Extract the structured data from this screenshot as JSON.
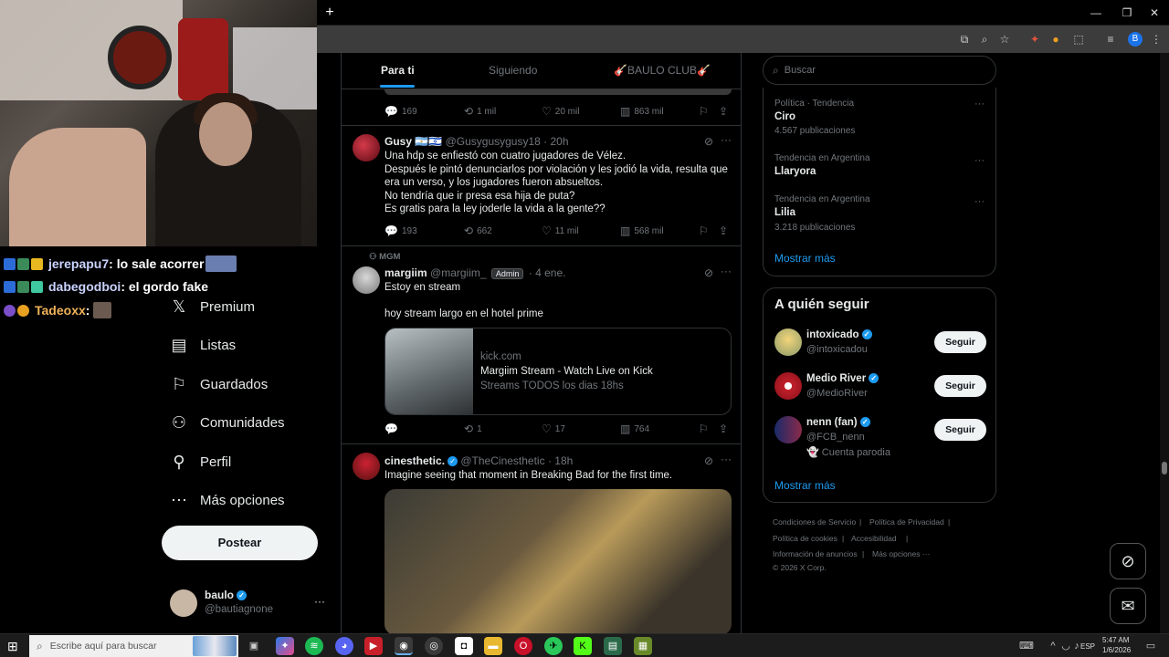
{
  "browser": {
    "newtab_label": "+",
    "minimize": "—",
    "restore": "❐",
    "close": "✕",
    "profile_initial": "B"
  },
  "chat": [
    {
      "user": "jerepapu7",
      "message": " : lo sale acorrer",
      "color": "#c9d3ff"
    },
    {
      "user": "dabegodboi",
      "message": " : el gordo fake",
      "color": "#c9d3ff"
    },
    {
      "user": "Tadeoxx",
      "message": " :",
      "color": "#f0b25a"
    }
  ],
  "nav": {
    "items": [
      {
        "label": "Premium",
        "icon": "x-logo-icon"
      },
      {
        "label": "Listas",
        "icon": "list-icon"
      },
      {
        "label": "Guardados",
        "icon": "bookmark-icon"
      },
      {
        "label": "Comunidades",
        "icon": "communities-icon"
      },
      {
        "label": "Perfil",
        "icon": "profile-icon"
      },
      {
        "label": "Más opciones",
        "icon": "more-options-icon"
      }
    ],
    "post_label": "Postear",
    "user_name": "baulo",
    "user_handle": "@bautiagnone",
    "user_more": "···"
  },
  "tabs": {
    "for_you": "Para ti",
    "following": "Siguiendo",
    "club": "🎸BAULO CLUB🎸"
  },
  "tweets": {
    "t0": {
      "replies": "169",
      "retweets": "1 mil",
      "likes": "20 mil",
      "views": "863 mil"
    },
    "t1": {
      "name": "Gusy 🇦🇷🇮🇱",
      "handle": "@Gusygusygusy18",
      "time": "· 20h",
      "line1": "Una hdp se enfiestó con cuatro jugadores de Vélez.",
      "line2": "Después le pintó denunciarlos por violación y les jodió la vida, resulta que era un verso, y los jugadores fueron absueltos.",
      "line3": "No tendría que ir presa esa hija de puta?",
      "line4": "Es gratis para la ley joderle la vida a la gente??",
      "replies": "193",
      "retweets": "662",
      "likes": "11 mil",
      "views": "568 mil"
    },
    "t2": {
      "context": "MGM",
      "name": "margiim",
      "handle": "@margiim_",
      "badge": "Admin",
      "time": "· 4 ene.",
      "line1": "Estoy en stream",
      "line2": "hoy stream largo en el hotel prime",
      "card_domain": "kick.com",
      "card_title": "Margiim Stream - Watch Live on Kick",
      "card_desc": "Streams TODOS los dias 18hs",
      "replies": "",
      "retweets": "1",
      "likes": "17",
      "views": "764"
    },
    "t3": {
      "name": "cinesthetic.",
      "handle": "@TheCinesthetic",
      "time": "· 18h",
      "line1": "Imagine seeing that moment in Breaking Bad for the first time."
    }
  },
  "search": {
    "placeholder": "Buscar"
  },
  "trends": [
    {
      "meta": "Política · Tendencia",
      "name": "Ciro",
      "posts": "4.567 publicaciones"
    },
    {
      "meta": "Tendencia en Argentina",
      "name": "Llaryora",
      "posts": ""
    },
    {
      "meta": "Tendencia en Argentina",
      "name": "Lilia",
      "posts": "3.218 publicaciones"
    }
  ],
  "trends_more": "Mostrar más",
  "follow": {
    "title": "A quién seguir",
    "button": "Seguir",
    "more": "Mostrar más",
    "people": [
      {
        "name": "intoxicado",
        "handle": "@intoxicadou",
        "extra": ""
      },
      {
        "name": "Medio River",
        "handle": "@MedioRiver",
        "extra": ""
      },
      {
        "name": "nenn (fan)",
        "handle": "@FCB_nenn",
        "extra": "👻 Cuenta parodia"
      }
    ]
  },
  "footer": {
    "terms": "Condiciones de Servicio",
    "privacy": "Política de Privacidad",
    "cookies": "Política de cookies",
    "access": "Accesibilidad",
    "ads": "Información de anuncios",
    "more": "Más opciones ···",
    "corp": "© 2026 X Corp."
  },
  "taskbar": {
    "search_placeholder": "Escribe aquí para buscar",
    "lang": "ESP",
    "time": "5:47 AM",
    "date": "1/6/2026"
  },
  "colors": {
    "accent": "#1d9bf0",
    "bg": "#000000",
    "border": "#2f3336",
    "muted": "#71767b"
  }
}
